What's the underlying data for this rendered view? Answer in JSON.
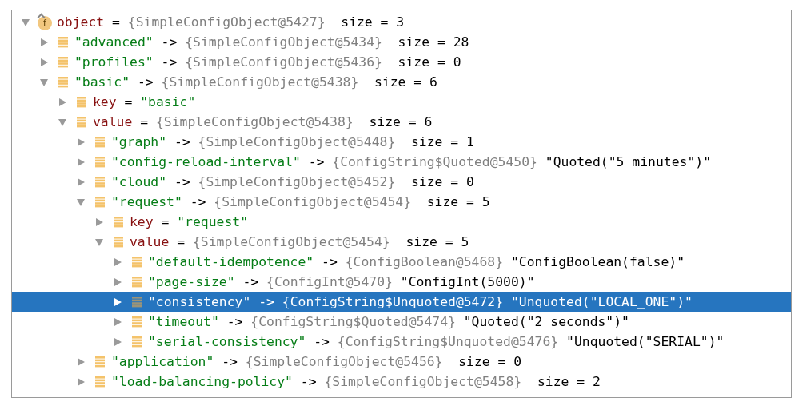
{
  "tree": [
    {
      "name": "object",
      "kind": "field",
      "badge": "f",
      "op": "=",
      "ref": "{SimpleConfigObject@5427}",
      "detail": "size = 3",
      "expanded": true,
      "selected": false,
      "children": [
        {
          "name": "\"advanced\"",
          "kind": "entry",
          "op": "->",
          "ref": "{SimpleConfigObject@5434}",
          "detail": "size = 28",
          "expanded": false,
          "selected": false
        },
        {
          "name": "\"profiles\"",
          "kind": "entry",
          "op": "->",
          "ref": "{SimpleConfigObject@5436}",
          "detail": "size = 0",
          "expanded": false,
          "selected": false
        },
        {
          "name": "\"basic\"",
          "kind": "entry",
          "op": "->",
          "ref": "{SimpleConfigObject@5438}",
          "detail": "size = 6",
          "expanded": true,
          "selected": false,
          "children": [
            {
              "name": "key",
              "kind": "entry",
              "op": "=",
              "string_value": "\"basic\"",
              "expanded": false,
              "selected": false
            },
            {
              "name": "value",
              "kind": "entry",
              "op": "=",
              "ref": "{SimpleConfigObject@5438}",
              "detail": "size = 6",
              "expanded": true,
              "selected": false,
              "children": [
                {
                  "name": "\"graph\"",
                  "kind": "entry",
                  "op": "->",
                  "ref": "{SimpleConfigObject@5448}",
                  "detail": "size = 1",
                  "expanded": false,
                  "selected": false
                },
                {
                  "name": "\"config-reload-interval\"",
                  "kind": "entry",
                  "op": "->",
                  "ref": "{ConfigString$Quoted@5450}",
                  "value": "\"Quoted(\"5 minutes\")\"",
                  "expanded": false,
                  "selected": false
                },
                {
                  "name": "\"cloud\"",
                  "kind": "entry",
                  "op": "->",
                  "ref": "{SimpleConfigObject@5452}",
                  "detail": "size = 0",
                  "expanded": false,
                  "selected": false
                },
                {
                  "name": "\"request\"",
                  "kind": "entry",
                  "op": "->",
                  "ref": "{SimpleConfigObject@5454}",
                  "detail": "size = 5",
                  "expanded": true,
                  "selected": false,
                  "children": [
                    {
                      "name": "key",
                      "kind": "entry",
                      "op": "=",
                      "string_value": "\"request\"",
                      "expanded": false,
                      "selected": false
                    },
                    {
                      "name": "value",
                      "kind": "entry",
                      "op": "=",
                      "ref": "{SimpleConfigObject@5454}",
                      "detail": "size = 5",
                      "expanded": true,
                      "selected": false,
                      "children": [
                        {
                          "name": "\"default-idempotence\"",
                          "kind": "entry",
                          "op": "->",
                          "ref": "{ConfigBoolean@5468}",
                          "value": "\"ConfigBoolean(false)\"",
                          "expanded": false,
                          "selected": false
                        },
                        {
                          "name": "\"page-size\"",
                          "kind": "entry",
                          "op": "->",
                          "ref": "{ConfigInt@5470}",
                          "value": "\"ConfigInt(5000)\"",
                          "expanded": false,
                          "selected": false
                        },
                        {
                          "name": "\"consistency\"",
                          "kind": "entry",
                          "op": "->",
                          "ref": "{ConfigString$Unquoted@5472}",
                          "value": "\"Unquoted(\"LOCAL_ONE\")\"",
                          "expanded": false,
                          "selected": true
                        },
                        {
                          "name": "\"timeout\"",
                          "kind": "entry",
                          "op": "->",
                          "ref": "{ConfigString$Quoted@5474}",
                          "value": "\"Quoted(\"2 seconds\")\"",
                          "expanded": false,
                          "selected": false
                        },
                        {
                          "name": "\"serial-consistency\"",
                          "kind": "entry",
                          "op": "->",
                          "ref": "{ConfigString$Unquoted@5476}",
                          "value": "\"Unquoted(\"SERIAL\")\"",
                          "expanded": false,
                          "selected": false
                        }
                      ]
                    }
                  ]
                },
                {
                  "name": "\"application\"",
                  "kind": "entry",
                  "op": "->",
                  "ref": "{SimpleConfigObject@5456}",
                  "detail": "size = 0",
                  "expanded": false,
                  "selected": false
                },
                {
                  "name": "\"load-balancing-policy\"",
                  "kind": "entry",
                  "op": "->",
                  "ref": "{SimpleConfigObject@5458}",
                  "detail": "size = 2",
                  "expanded": false,
                  "selected": false
                }
              ]
            }
          ]
        }
      ]
    }
  ]
}
